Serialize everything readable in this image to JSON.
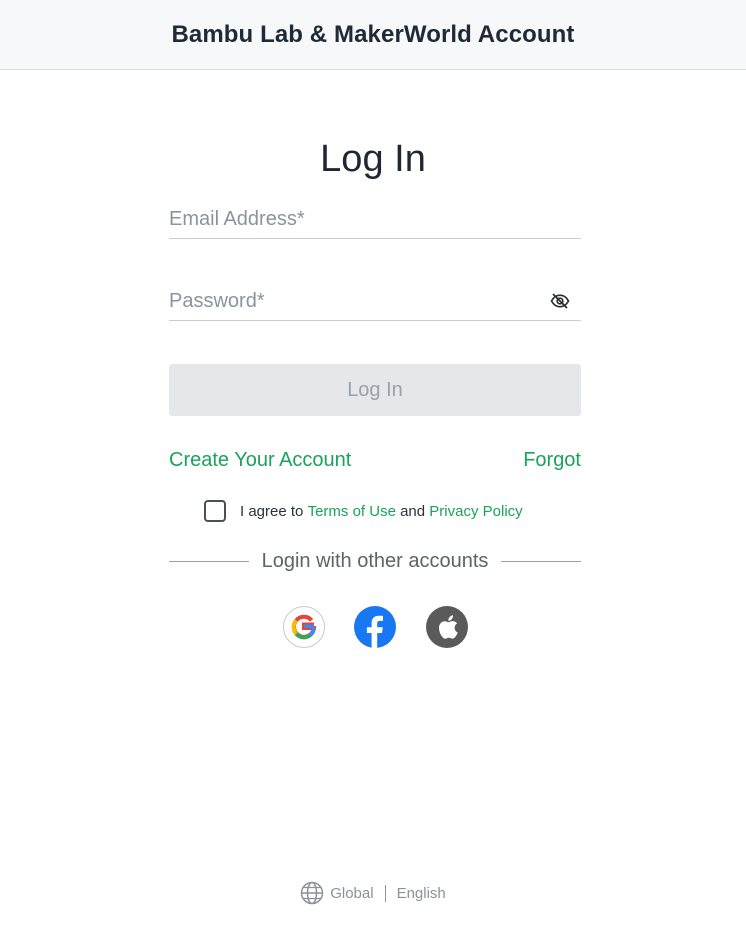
{
  "header": {
    "title": "Bambu Lab & MakerWorld Account"
  },
  "form": {
    "heading": "Log In",
    "email": {
      "placeholder": "Email Address*",
      "value": ""
    },
    "password": {
      "placeholder": "Password*",
      "value": "",
      "toggle_icon": "eye-slash-icon"
    },
    "submit_label": "Log In",
    "create_account_label": "Create Your Account",
    "forgot_label": "Forgot"
  },
  "agreement": {
    "prefix": "I agree to",
    "terms_label": "Terms of Use",
    "conjunction": "and",
    "privacy_label": "Privacy Policy",
    "checked": false
  },
  "social": {
    "divider_text": "Login with other accounts",
    "providers": [
      "google-icon",
      "facebook-icon",
      "apple-icon"
    ]
  },
  "footer": {
    "region": "Global",
    "language": "English"
  },
  "colors": {
    "accent": "#1aa35a",
    "button_disabled_bg": "#e5e7ea",
    "button_disabled_text": "#9aa1a9",
    "facebook": "#1877f2",
    "apple": "#5a5a5a"
  }
}
